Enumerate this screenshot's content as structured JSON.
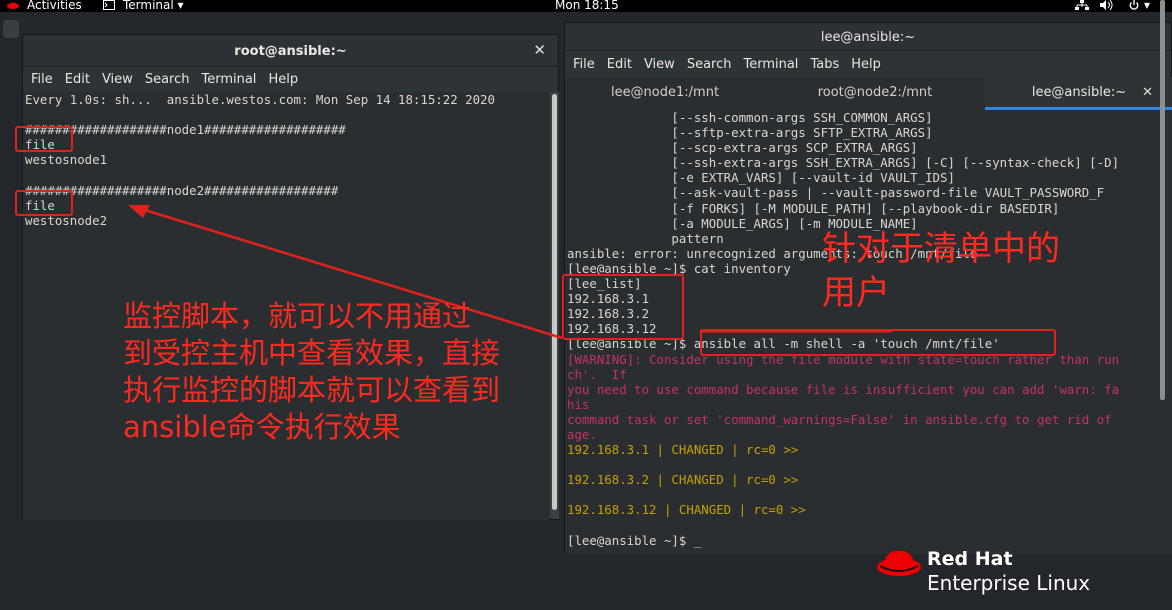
{
  "topbar": {
    "activities": "Activities",
    "app_menu": "Terminal",
    "clock": "Mon 18:15"
  },
  "left_window": {
    "title": "root@ansible:~",
    "menu": [
      "File",
      "Edit",
      "View",
      "Search",
      "Terminal",
      "Help"
    ],
    "lines": [
      "Every 1.0s: sh...  ansible.westos.com: Mon Sep 14 18:15:22 2020",
      "",
      "###################node1###################",
      "file",
      "westosnode1",
      "",
      "###################node2##################",
      "file",
      "westosnode2"
    ]
  },
  "right_window": {
    "title": "lee@ansible:~",
    "menu": [
      "File",
      "Edit",
      "View",
      "Search",
      "Terminal",
      "Tabs",
      "Help"
    ],
    "tabs": [
      "lee@node1:/mnt",
      "root@node2:/mnt",
      "lee@ansible:~"
    ],
    "lines": [
      "              [--ssh-common-args SSH_COMMON_ARGS]",
      "              [--sftp-extra-args SFTP_EXTRA_ARGS]",
      "              [--scp-extra-args SCP_EXTRA_ARGS]",
      "              [--ssh-extra-args SSH_EXTRA_ARGS] [-C] [--syntax-check] [-D]",
      "              [-e EXTRA_VARS] [--vault-id VAULT_IDS]",
      "              [--ask-vault-pass | --vault-password-file VAULT_PASSWORD_F",
      "              [-f FORKS] [-M MODULE_PATH] [--playbook-dir BASEDIR]",
      "              [-a MODULE_ARGS] [-m MODULE_NAME]",
      "              pattern",
      "ansible: error: unrecognized arguments: touch /mnt/file",
      "[lee@ansible ~]$ cat inventory",
      "[lee_list]",
      "192.168.3.1",
      "192.168.3.2",
      "192.168.3.12",
      "[lee@ansible ~]$ ansible all -m shell -a 'touch /mnt/file'"
    ],
    "warning_lines": [
      "[WARNING]: Consider using the file module with state=touch rather than run",
      "ch'.  If",
      "you need to use command because file is insufficient you can add 'warn: fa",
      "his",
      "command task or set 'command_warnings=False' in ansible.cfg to get rid of",
      "age."
    ],
    "result_lines": [
      "192.168.3.1 | CHANGED | rc=0 >>",
      "",
      "192.168.3.2 | CHANGED | rc=0 >>",
      "",
      "192.168.3.12 | CHANGED | rc=0 >>",
      ""
    ],
    "prompt_line": "[lee@ansible ~]$ _"
  },
  "annotations": {
    "left_note": "监控脚本，就可以不用通过\n到受控主机中查看效果，直接\n执行监控的脚本就可以查看到\nansible命令执行效果",
    "right_note": "针对于清单中的\n用户"
  },
  "branding": {
    "line1": "Red Hat",
    "line2": "Enterprise Linux"
  },
  "colors": {
    "annotation_red": "#e0221a",
    "warning_pink": "#c4306b",
    "changed_yellow": "#c4a000",
    "tab_accent": "#3584e4"
  }
}
